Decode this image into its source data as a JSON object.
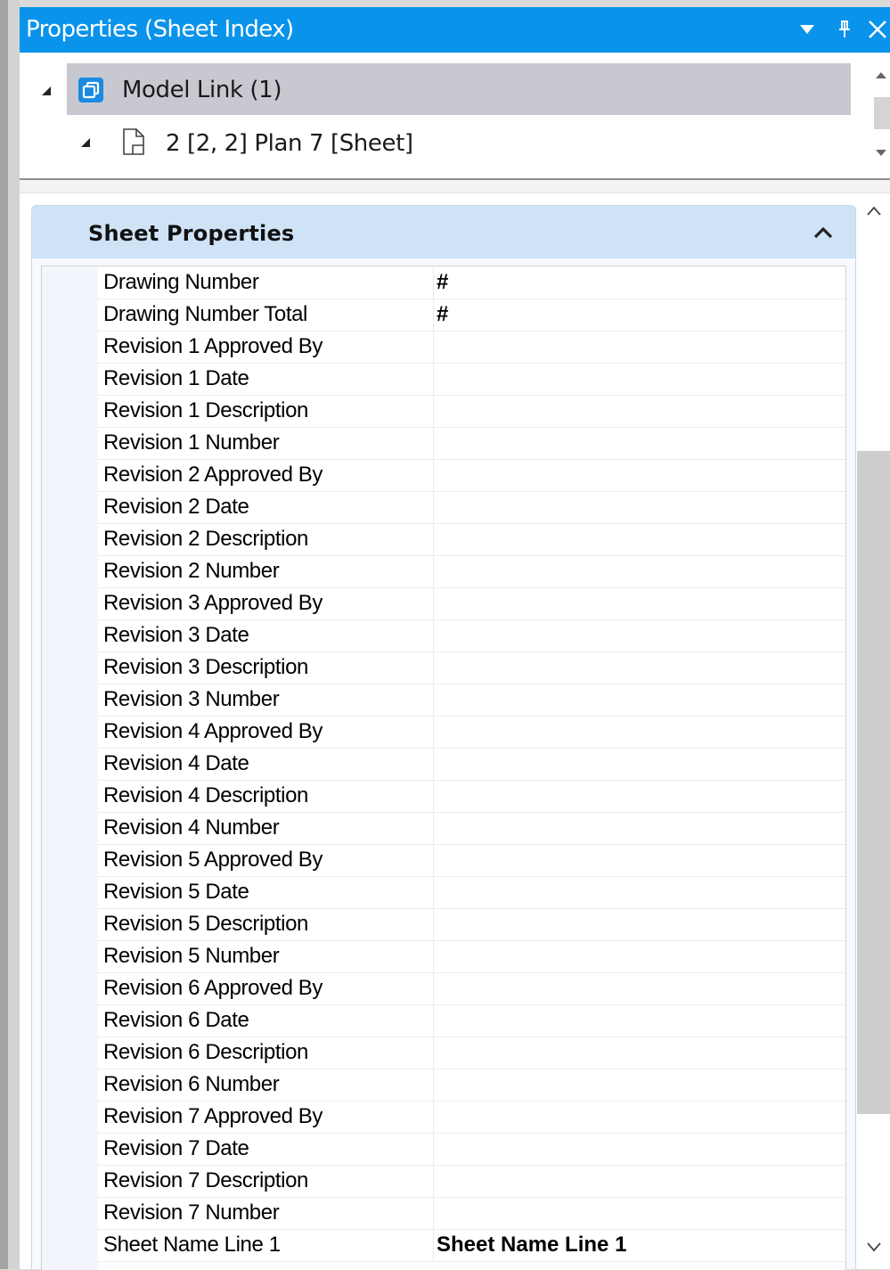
{
  "window": {
    "title": "Properties (Sheet Index)",
    "buttons": {
      "dropdown_icon": "chevron-down-icon",
      "pin_icon": "pin-icon",
      "close_icon": "close-icon"
    }
  },
  "tree": {
    "items": [
      {
        "label": "Model Link (1)",
        "icon": "model-link-icon",
        "expanded": true,
        "selected": true
      },
      {
        "label": "2 [2, 2] Plan 7 [Sheet]",
        "icon": "sheet-icon",
        "expanded": true
      }
    ]
  },
  "section": {
    "title": "Sheet Properties",
    "collapse_icon": "chevron-up-icon"
  },
  "properties": [
    {
      "name": "Drawing Number",
      "value": "#"
    },
    {
      "name": "Drawing Number Total",
      "value": "#"
    },
    {
      "name": "Revision 1 Approved By",
      "value": ""
    },
    {
      "name": "Revision 1 Date",
      "value": ""
    },
    {
      "name": "Revision 1 Description",
      "value": ""
    },
    {
      "name": "Revision 1 Number",
      "value": ""
    },
    {
      "name": "Revision 2 Approved By",
      "value": ""
    },
    {
      "name": "Revision 2 Date",
      "value": ""
    },
    {
      "name": "Revision 2 Description",
      "value": ""
    },
    {
      "name": "Revision 2 Number",
      "value": ""
    },
    {
      "name": "Revision 3 Approved By",
      "value": ""
    },
    {
      "name": "Revision 3 Date",
      "value": ""
    },
    {
      "name": "Revision 3 Description",
      "value": ""
    },
    {
      "name": "Revision 3 Number",
      "value": ""
    },
    {
      "name": "Revision 4 Approved By",
      "value": ""
    },
    {
      "name": "Revision 4 Date",
      "value": ""
    },
    {
      "name": "Revision 4 Description",
      "value": ""
    },
    {
      "name": "Revision 4 Number",
      "value": ""
    },
    {
      "name": "Revision 5 Approved By",
      "value": ""
    },
    {
      "name": "Revision 5 Date",
      "value": ""
    },
    {
      "name": "Revision 5 Description",
      "value": ""
    },
    {
      "name": "Revision 5 Number",
      "value": ""
    },
    {
      "name": "Revision 6 Approved By",
      "value": ""
    },
    {
      "name": "Revision 6 Date",
      "value": ""
    },
    {
      "name": "Revision 6 Description",
      "value": ""
    },
    {
      "name": "Revision 6 Number",
      "value": ""
    },
    {
      "name": "Revision 7 Approved By",
      "value": ""
    },
    {
      "name": "Revision 7 Date",
      "value": ""
    },
    {
      "name": "Revision 7 Description",
      "value": ""
    },
    {
      "name": "Revision 7 Number",
      "value": ""
    },
    {
      "name": "Sheet Name Line 1",
      "value": "Sheet Name Line 1"
    }
  ],
  "colors": {
    "titlebar": "#0a93ea",
    "selected_row": "#c8c8d0",
    "section_header": "#cfe3f6",
    "model_icon": "#1b8ae0"
  }
}
